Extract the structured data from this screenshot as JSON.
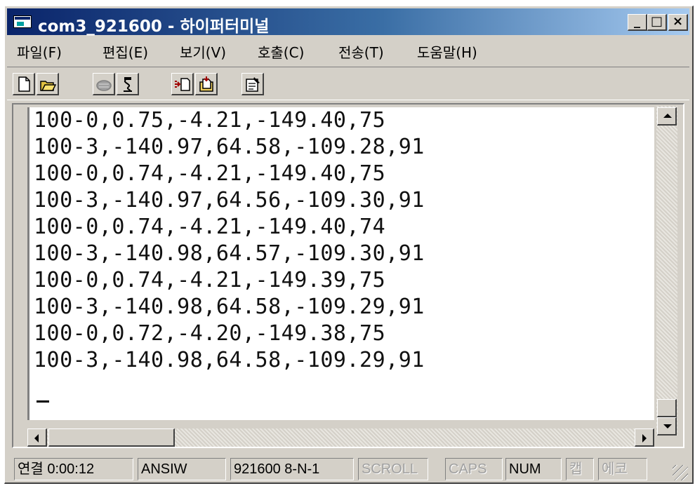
{
  "window": {
    "title": "com3_921600 - 하이퍼터미널",
    "controls": {
      "minimize": "_",
      "maximize": "□",
      "close": "×"
    }
  },
  "menu": {
    "items": [
      "파일(F)",
      "편집(E)",
      "보기(V)",
      "호출(C)",
      "전송(T)",
      "도움말(H)"
    ]
  },
  "toolbar": {
    "buttons": [
      "new-connection",
      "open",
      "connect",
      "disconnect",
      "send",
      "receive",
      "properties"
    ]
  },
  "terminal": {
    "lines": [
      "100-0,0.75,-4.21,-149.40,75",
      "100-3,-140.97,64.58,-109.28,91",
      "100-0,0.74,-4.21,-149.40,75",
      "100-3,-140.97,64.56,-109.30,91",
      "100-0,0.74,-4.21,-149.40,74",
      "100-3,-140.98,64.57,-109.30,91",
      "100-0,0.74,-4.21,-149.39,75",
      "100-3,-140.98,64.58,-109.29,91",
      "100-0,0.72,-4.20,-149.38,75",
      "100-3,-140.98,64.58,-109.29,91"
    ],
    "cursor": "_"
  },
  "status": {
    "connection": "연결 0:00:12",
    "emulation": "ANSIW",
    "port_settings": "921600 8-N-1",
    "scroll": "SCROLL",
    "caps": "CAPS",
    "num": "NUM",
    "capture": "캡",
    "echo": "에코"
  },
  "colors": {
    "title_bar_start": "#0a246a",
    "title_bar_end": "#a6caf0",
    "window_face": "#d4d0c8",
    "terminal_bg": "#ffffff"
  }
}
